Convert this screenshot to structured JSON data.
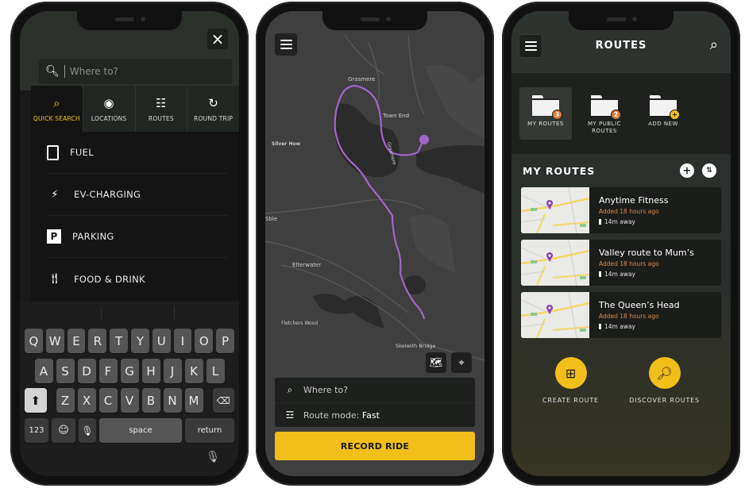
{
  "search_screen": {
    "close_icon": "close-icon",
    "search": {
      "placeholder": "Where to?",
      "value": ""
    },
    "tabs": [
      {
        "label": "QUICK SEARCH",
        "icon": "search-icon",
        "active": true
      },
      {
        "label": "LOCATIONS",
        "icon": "location-pin-icon",
        "active": false
      },
      {
        "label": "ROUTES",
        "icon": "route-icon",
        "active": false
      },
      {
        "label": "ROUND TRIP",
        "icon": "round-trip-icon",
        "active": false
      }
    ],
    "categories": [
      {
        "label": "FUEL",
        "icon": "fuel-icon"
      },
      {
        "label": "EV-CHARGING",
        "icon": "ev-charging-icon"
      },
      {
        "label": "PARKING",
        "icon": "parking-icon"
      },
      {
        "label": "FOOD & DRINK",
        "icon": "food-drink-icon"
      }
    ],
    "keyboard": {
      "row1": [
        "Q",
        "W",
        "E",
        "R",
        "T",
        "Y",
        "U",
        "I",
        "O",
        "P"
      ],
      "row2": [
        "A",
        "S",
        "D",
        "F",
        "G",
        "H",
        "J",
        "K",
        "L"
      ],
      "row3": [
        "Z",
        "X",
        "C",
        "V",
        "B",
        "N",
        "M"
      ],
      "numbers_label": "123",
      "space_label": "space",
      "return_label": "return"
    }
  },
  "map_screen": {
    "labels": {
      "grasmere": "Grasmere",
      "town_end": "Town End",
      "silver_how": "Silver How",
      "lake": "Grasmere",
      "ble": "Sble",
      "elterwater": "Elterwater",
      "fletchers_wood": "Fletchers Wood",
      "skelwith_bridge": "Skelwith Bridge"
    },
    "search_placeholder": "Where to?",
    "route_mode_label": "Route mode:",
    "route_mode_value": "Fast",
    "record_button": "RECORD RIDE",
    "route_color": "#a066c8"
  },
  "routes_screen": {
    "title": "ROUTES",
    "folders": [
      {
        "label": "MY ROUTES",
        "badge": "3",
        "badge_color": "#d97a3a",
        "active": true
      },
      {
        "label": "MY PUBLIC ROUTES",
        "badge": "2",
        "badge_color": "#d97a3a",
        "active": false
      },
      {
        "label": "ADD NEW",
        "badge": "+",
        "badge_color": "#f2be1a",
        "active": false
      }
    ],
    "section_title": "MY ROUTES",
    "routes": [
      {
        "name": "Anytime Fitness",
        "added": "Added 18 hours ago",
        "distance": "14m away"
      },
      {
        "name": "Valley route to Mum’s",
        "added": "Added 18 hours ago",
        "distance": "14m away"
      },
      {
        "name": "The Queen’s Head",
        "added": "Added 18 hours ago",
        "distance": "14m away"
      }
    ],
    "actions": [
      {
        "label": "CREATE ROUTE",
        "icon": "create-route-icon"
      },
      {
        "label": "DISCOVER ROUTES",
        "icon": "discover-routes-icon"
      }
    ],
    "accent_color": "#f2be1a"
  }
}
